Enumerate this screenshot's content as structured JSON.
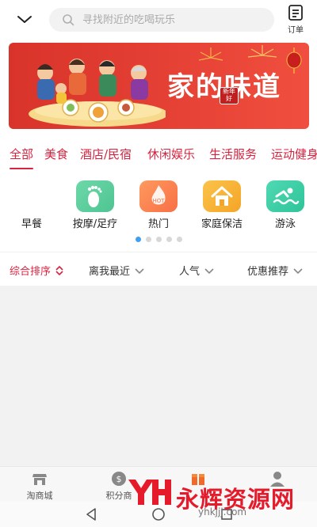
{
  "header": {
    "search_placeholder": "寻找附近的吃喝玩乐",
    "orders_label": "订单"
  },
  "banner": {
    "title": "家的味道",
    "seal_text": "新年好"
  },
  "category_tabs": [
    {
      "label": "全部"
    },
    {
      "label": "美食"
    },
    {
      "label": "酒店/民宿"
    },
    {
      "label": "休闲娱乐"
    },
    {
      "label": "生活服务"
    },
    {
      "label": "运动健身"
    }
  ],
  "icon_items": [
    {
      "label": "早餐",
      "icon": "breakfast-icon"
    },
    {
      "label": "按摩/足疗",
      "icon": "footprint-icon"
    },
    {
      "label": "热门",
      "icon": "hot-flame-icon",
      "badge": "HOT"
    },
    {
      "label": "家庭保洁",
      "icon": "house-cleaning-icon"
    },
    {
      "label": "游泳",
      "icon": "swimming-icon"
    }
  ],
  "pagination": {
    "pages": 5,
    "current": 1
  },
  "filters": [
    {
      "label": "综合排序"
    },
    {
      "label": "离我最近"
    },
    {
      "label": "人气"
    },
    {
      "label": "优惠推荐"
    }
  ],
  "bottom_nav": [
    {
      "label": "淘商城",
      "icon": "store-icon"
    },
    {
      "label": "积分商",
      "icon": "coin-icon"
    },
    {
      "label": "",
      "icon": "gift-box-icon"
    },
    {
      "label": "",
      "icon": "user-icon"
    }
  ],
  "watermark": {
    "text": "永辉资源网",
    "url": "yhkjjj.com"
  },
  "colors": {
    "accent": "#d7233f",
    "banner_red": "#e33e33",
    "dot_active": "#3ea0f2",
    "icon_massage": "#5fcf9f",
    "icon_hot": "#fb8a52",
    "icon_cleaning": "#f7b13a",
    "icon_swim": "#3ccfa6"
  }
}
